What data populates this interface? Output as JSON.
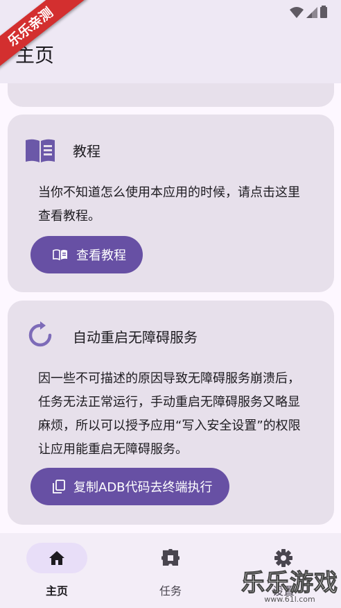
{
  "badge": {
    "text": "乐乐亲测"
  },
  "app_bar": {
    "title": "主页"
  },
  "cards": [
    {
      "title": "教程",
      "icon": "book-icon",
      "body": "当你不知道怎么使用本应用的时候，请点击这里查看教程。",
      "button": {
        "label": "查看教程",
        "icon": "book-small-icon"
      }
    },
    {
      "title": "自动重启无障碍服务",
      "icon": "refresh-icon",
      "body": "因一些不可描述的原因导致无障碍服务崩溃后，任务无法正常运行，手动重启无障碍服务又略显麻烦，所以可以授予应用“写入安全设置”的权限让应用能重启无障碍服务。",
      "button": {
        "label": "复制ADB代码去终端执行",
        "icon": "copy-icon"
      }
    }
  ],
  "nav": [
    {
      "label": "主页",
      "icon": "home-icon",
      "active": true
    },
    {
      "label": "任务",
      "icon": "puzzle-icon",
      "active": false
    },
    {
      "label": "设置",
      "icon": "settings-icon",
      "active": false
    }
  ],
  "watermark": {
    "text": "乐乐游戏",
    "url": "www.61l.com"
  },
  "colors": {
    "primary": "#6750a4",
    "card_bg": "#e7e0eb",
    "app_bar_bg": "#eee8f4",
    "badge": "#d32f2f"
  }
}
